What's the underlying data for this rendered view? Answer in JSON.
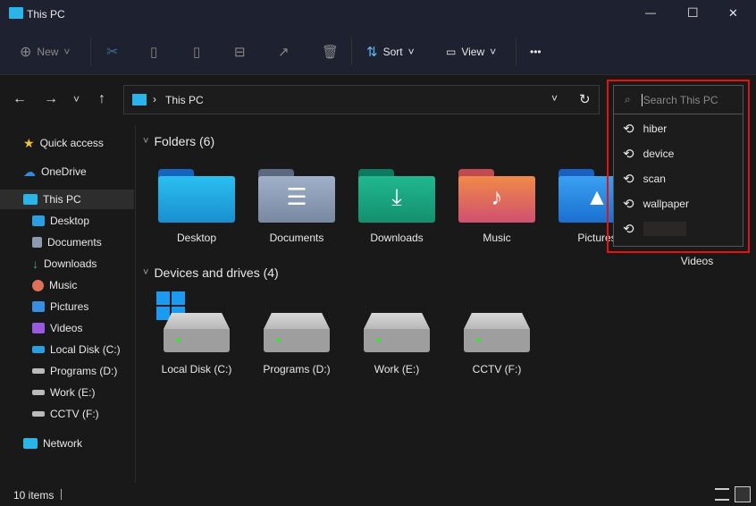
{
  "window": {
    "title": "This PC",
    "minimize": "—",
    "maximize": "☐",
    "close": "✕"
  },
  "toolbar": {
    "new": "New",
    "sort": "Sort",
    "view": "View",
    "more": "•••"
  },
  "address": {
    "location": "This PC",
    "separator": "›"
  },
  "search": {
    "placeholder": "Search This PC",
    "history": [
      "hiber",
      "device",
      "scan",
      "wallpaper",
      ""
    ]
  },
  "sidebar": {
    "items": [
      {
        "label": "Quick access",
        "color": "#f2c233"
      },
      {
        "label": "OneDrive",
        "color": "#2f8ae0"
      },
      {
        "label": "This PC",
        "color": "#2bb4e8"
      },
      {
        "label": "Desktop",
        "color": "#2b9ee0"
      },
      {
        "label": "Documents",
        "color": "#8c9bb0"
      },
      {
        "label": "Downloads",
        "color": "#2bb888"
      },
      {
        "label": "Music",
        "color": "#e0705a"
      },
      {
        "label": "Pictures",
        "color": "#3a8ee0"
      },
      {
        "label": "Videos",
        "color": "#9a5ae0"
      },
      {
        "label": "Local Disk (C:)",
        "color": "#2b9ee0"
      },
      {
        "label": "Programs (D:)",
        "color": "#bbbbbb"
      },
      {
        "label": "Work (E:)",
        "color": "#bbbbbb"
      },
      {
        "label": "CCTV (F:)",
        "color": "#bbbbbb"
      },
      {
        "label": "Network",
        "color": "#2bb4e8"
      }
    ]
  },
  "folders": {
    "heading": "Folders (6)",
    "items": [
      {
        "label": "Desktop",
        "color": "#1aa6e0",
        "back": "#1565c0",
        "glyph": ""
      },
      {
        "label": "Documents",
        "color": "#8796b0",
        "back": "#5c6880",
        "glyph": "☰"
      },
      {
        "label": "Downloads",
        "color": "#18a888",
        "back": "#0d7a60",
        "glyph": "⤓"
      },
      {
        "label": "Music",
        "color": "#e8704a",
        "back": "#c04a50",
        "glyph": "♪"
      },
      {
        "label": "Pictures",
        "color": "#2a90e8",
        "back": "#1a60c0",
        "glyph": "▲"
      },
      {
        "label": "Videos"
      }
    ]
  },
  "drives": {
    "heading": "Devices and drives (4)",
    "items": [
      "Local Disk (C:)",
      "Programs (D:)",
      "Work (E:)",
      "CCTV (F:)"
    ]
  },
  "status": {
    "count": "10 items"
  }
}
